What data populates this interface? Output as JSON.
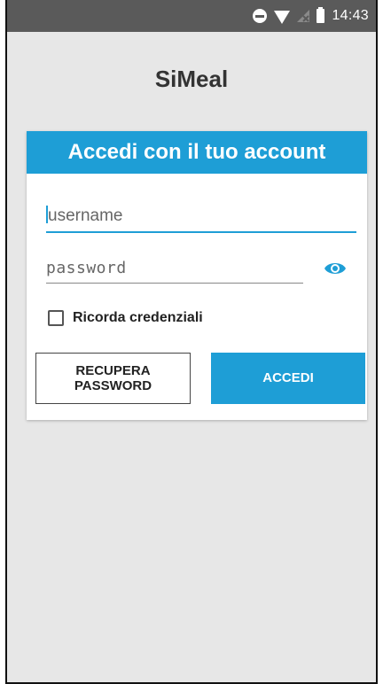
{
  "status_bar": {
    "time": "14:43",
    "icons": [
      "do-not-disturb-icon",
      "wifi-icon",
      "no-signal-icon",
      "battery-icon"
    ]
  },
  "app": {
    "title": "SiMeal"
  },
  "login_card": {
    "header": "Accedi con il tuo account",
    "username_placeholder": "username",
    "password_placeholder": "password",
    "show_password_icon": "eye-icon",
    "remember_label": "Ricorda credenziali",
    "remember_checked": false,
    "recover_button": "RECUPERA\nPASSWORD",
    "login_button": "ACCEDI"
  },
  "colors": {
    "accent": "#1e9ed6",
    "background": "#e7e7e7",
    "status_bar": "#5a5a5a"
  }
}
